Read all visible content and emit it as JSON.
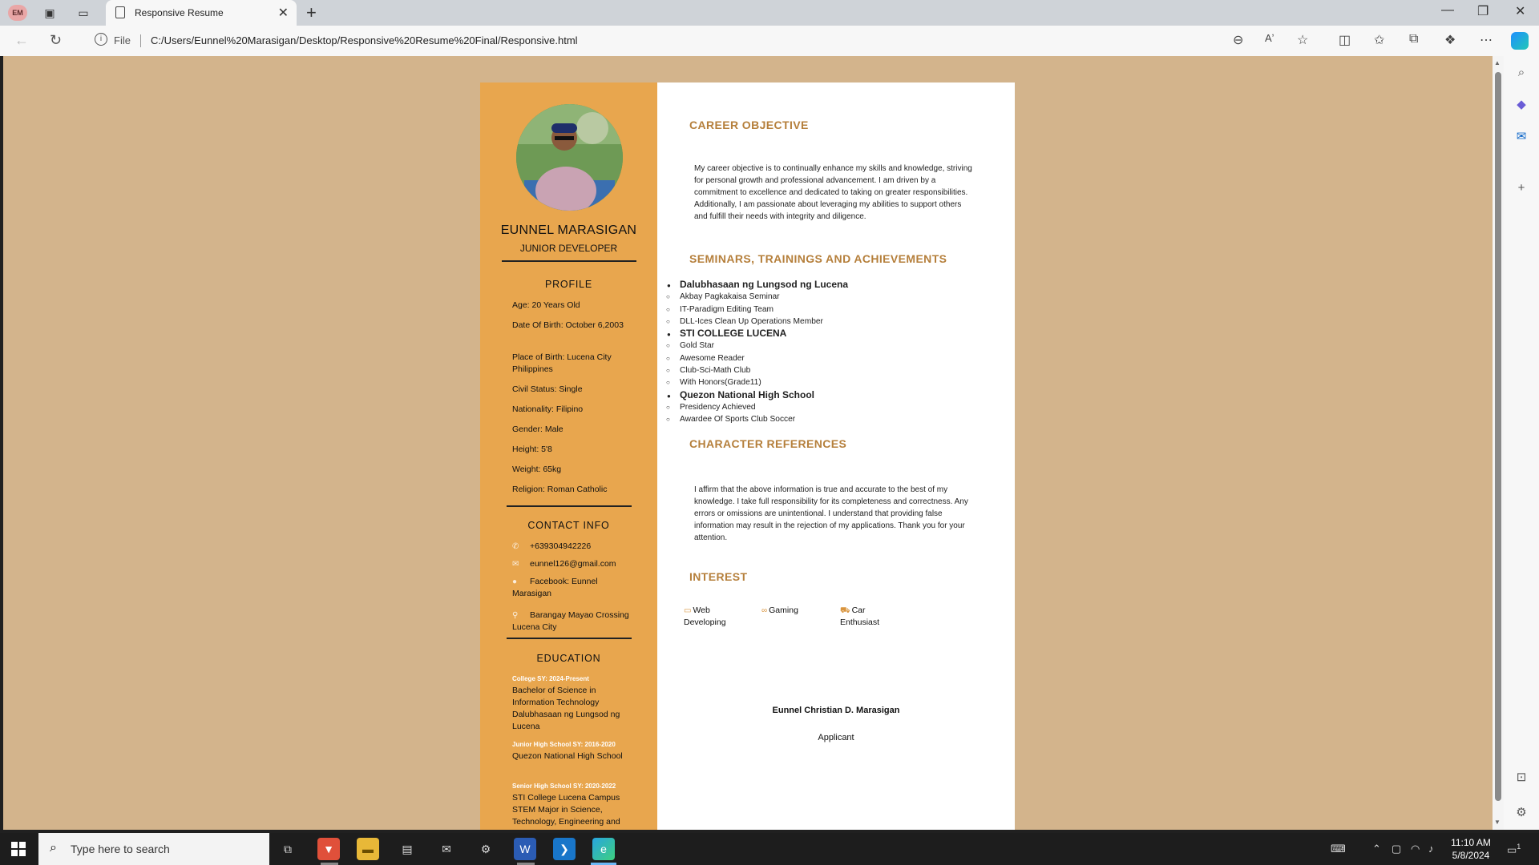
{
  "browser": {
    "profile_initials": "EM",
    "tab_title": "Responsive Resume",
    "url_scheme": "File",
    "url": "C:/Users/Eunnel%20Marasigan/Desktop/Responsive%20Resume%20Final/Responsive.html"
  },
  "resume": {
    "name": "EUNNEL MARASIGAN",
    "role": "JUNIOR DEVELOPER",
    "profile": {
      "heading": "PROFILE",
      "items": [
        "Age: 20 Years Old",
        "Date Of Birth: October 6,2003",
        "Place of Birth: Lucena City Philippines",
        "Civil Status: Single",
        "Nationality: Filipino",
        "Gender: Male",
        "Height: 5'8",
        "Weight: 65kg",
        "Religion: Roman Catholic"
      ]
    },
    "contact": {
      "heading": "CONTACT INFO",
      "phone": "+639304942226",
      "email": "eunnel126@gmail.com",
      "facebook": "Facebook: Eunnel Marasigan",
      "address": "Barangay Mayao Crossing Lucena City"
    },
    "education": {
      "heading": "EDUCATION",
      "entries": [
        {
          "sub": "College SY: 2024-Present",
          "text": "Bachelor of Science in Information Technology Dalubhasaan ng Lungsod ng Lucena"
        },
        {
          "sub": "Junior High School SY: 2016-2020",
          "text": "Quezon National High School"
        },
        {
          "sub": "Senior High School SY: 2020-2022",
          "text": "STI College Lucena Campus STEM Major in Science, Technology, Engineering and"
        }
      ]
    },
    "career": {
      "heading": "CAREER OBJECTIVE",
      "text": "My career objective is to continually enhance my skills and knowledge, striving for personal growth and professional advancement. I am driven by a commitment to excellence and dedicated to taking on greater responsibilities. Additionally, I am passionate about leveraging my abilities to support others and fulfill their needs with integrity and diligence."
    },
    "seminars": {
      "heading": "SEMINARS, TRAININGS AND ACHIEVEMENTS",
      "groups": [
        {
          "title": "Dalubhasaan ng Lungsod ng Lucena",
          "items": [
            "Akbay Pagkakaisa Seminar",
            "IT-Paradigm Editing Team",
            "DLL-Ices Clean Up Operations Member"
          ]
        },
        {
          "title": "STI COLLEGE LUCENA",
          "items": [
            "Gold Star",
            "Awesome Reader",
            "Club-Sci-Math Club",
            "With Honors(Grade11)"
          ]
        },
        {
          "title": "Quezon National High School",
          "items": [
            "Presidency Achieved",
            "Awardee Of Sports Club Soccer"
          ]
        }
      ]
    },
    "references": {
      "heading": "CHARACTER REFERENCES",
      "text": "I affirm that the above information is true and accurate to the best of my knowledge. I take full responsibility for its completeness and correctness. Any errors or omissions are unintentional. I understand that providing false information may result in the rejection of my applications. Thank you for your attention."
    },
    "interest": {
      "heading": "INTEREST",
      "items": [
        "Web Developing",
        "Gaming",
        "Car Enthusiast"
      ]
    },
    "signature": {
      "name": "Eunnel Christian D. Marasigan",
      "title": "Applicant"
    }
  },
  "taskbar": {
    "search_placeholder": "Type here to search",
    "time": "11:10 AM",
    "date": "5/8/2024",
    "notification_count": "1"
  },
  "colors": {
    "page_bg": "#d3b48c",
    "sidebar": "#e8a64e",
    "heading_accent": "#b57f3b"
  }
}
